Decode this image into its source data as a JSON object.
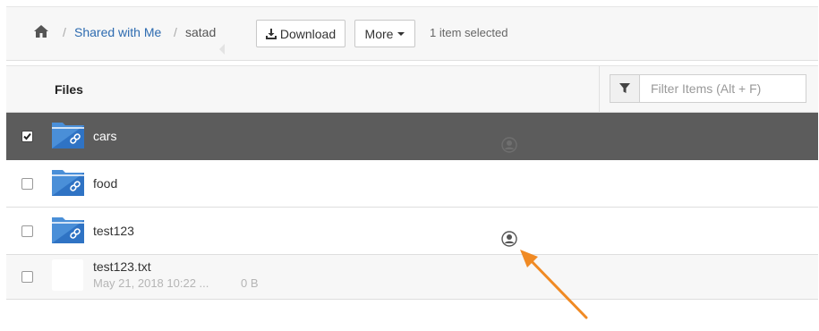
{
  "breadcrumb": {
    "home_icon": "home-icon",
    "separator": "/",
    "parent": "Shared with Me",
    "current": "satad"
  },
  "toolbar": {
    "download_label": "Download",
    "download_icon": "download-icon",
    "more_label": "More",
    "selection_status": "1 item selected"
  },
  "files_header": {
    "title": "Files",
    "filter_placeholder": "Filter Items (Alt + F)",
    "filter_value": "",
    "filter_icon": "filter-icon"
  },
  "items": [
    {
      "name": "cars",
      "type": "folder",
      "selected": true,
      "shared": true
    },
    {
      "name": "food",
      "type": "folder",
      "selected": false,
      "shared": false
    },
    {
      "name": "test123",
      "type": "folder",
      "selected": false,
      "shared": true
    },
    {
      "name": "test123.txt",
      "type": "file",
      "selected": false,
      "modified": "May 21, 2018 10:22 ...",
      "size": "0 B"
    }
  ],
  "colors": {
    "accent_link": "#2d6bb0",
    "folder_blue": "#4a8fd8",
    "selected_row": "#5c5c5c",
    "annotation_arrow": "#f08a24"
  }
}
